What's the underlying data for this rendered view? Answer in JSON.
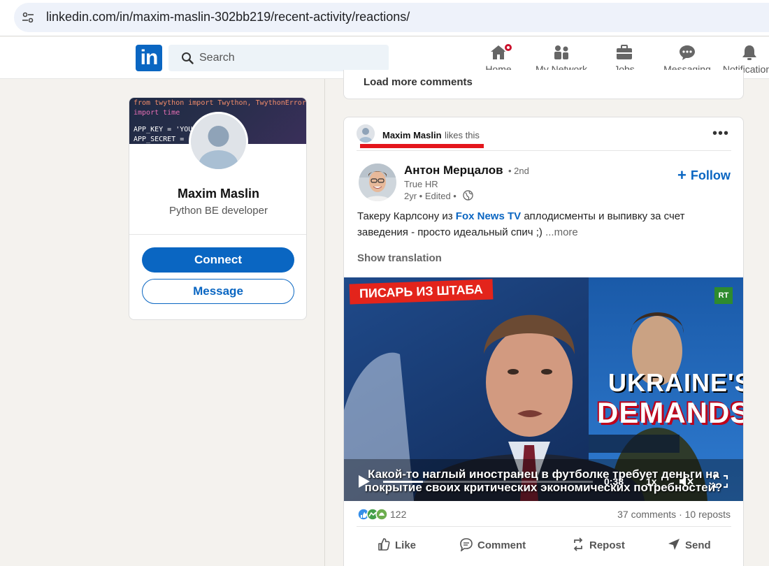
{
  "browser": {
    "url": "linkedin.com/in/maxim-maslin-302bb219/recent-activity/reactions/"
  },
  "header": {
    "logo": "in",
    "search_placeholder": "Search",
    "nav": [
      {
        "label": "Home",
        "icon": "home-icon",
        "has_badge": true
      },
      {
        "label": "My Network",
        "icon": "network-icon"
      },
      {
        "label": "Jobs",
        "icon": "briefcase-icon"
      },
      {
        "label": "Messaging",
        "icon": "messaging-icon"
      },
      {
        "label": "Notifications",
        "icon": "bell-icon"
      }
    ]
  },
  "profile": {
    "banner_code": [
      "from twython import Twython, TwythonError",
      "import time",
      "APP_KEY = 'YOUR KEY'",
      "APP_SECRET = 'YOUR SECRET'"
    ],
    "name": "Maxim Maslin",
    "title": "Python BE developer",
    "connect_label": "Connect",
    "message_label": "Message"
  },
  "previous_post": {
    "load_more_label": "Load more comments"
  },
  "post": {
    "activity_actor": "Maxim Maslin",
    "activity_verb": "likes this",
    "more_icon": "more-horizontal-icon",
    "author": {
      "name": "Антон Мерцалов",
      "degree": "• 2nd",
      "company": "True HR",
      "meta": "2yr • Edited •"
    },
    "follow_label": "Follow",
    "text_before": "Такеру Карлсону из ",
    "text_link": "Fox News TV",
    "text_after": " аплодисменты и выпивку за счет заведения - просто идеальный спич ;)  ",
    "see_more": "...more",
    "show_translation": "Show translation",
    "video": {
      "tag": "ПИСАРЬ ИЗ ШТАБА",
      "channel_logo": "RT",
      "headline_1": "UKRAINE'S",
      "headline_2": "DEMANDS",
      "subtitle_1": "Какой-то наглый иностранец в футболке требует деньги на",
      "subtitle_2": "покрытие своих критических экономических потребностей?",
      "time": "0:38",
      "speed": "1x",
      "progress": 0.19
    },
    "reaction_count": "122",
    "comments_reposts": "37 comments · 10 reposts",
    "actions": {
      "like": "Like",
      "comment": "Comment",
      "repost": "Repost",
      "send": "Send"
    }
  },
  "colors": {
    "brand": "#0a66c2",
    "badge": "#cb112d",
    "highlight_underline": "#e4161c"
  }
}
